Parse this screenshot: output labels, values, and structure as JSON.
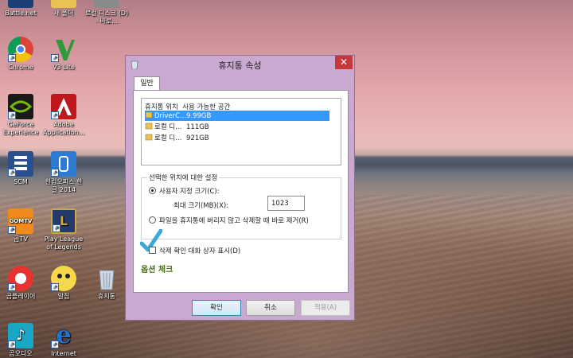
{
  "desktop": {
    "icons": [
      {
        "label": "Battle.net",
        "color": "#1c3f7a"
      },
      {
        "label": "새 폴더",
        "color": "#e8c252"
      },
      {
        "label": "로컬 디스크 (D) - 바로...",
        "color": "#8a8a8a"
      },
      {
        "label": "Chrome",
        "color": "#3a7de0"
      },
      {
        "label": "V3 Lite",
        "color": "#2f9a3a"
      },
      {
        "label": "GeForce Experience",
        "color": "#76b900"
      },
      {
        "label": "Adobe Application...",
        "color": "#c0171c"
      },
      {
        "label": "SCM",
        "color": "#2a4f8f"
      },
      {
        "label": "한컴오피스 한글 2014",
        "color": "#2e7bd4"
      },
      {
        "label": "곰TV",
        "color": "#f08a1d"
      },
      {
        "label": "Play League of Legends",
        "color": "#243a6a"
      },
      {
        "label": "곰플레이어",
        "color": "#e8322f"
      },
      {
        "label": "알집",
        "color": "#f6d84a"
      },
      {
        "label": "휴지통",
        "color": "#9aa6b4"
      },
      {
        "label": "곰오디오",
        "color": "#1aa7c6"
      },
      {
        "label": "Internet Explorer",
        "color": "#1f73d1"
      }
    ]
  },
  "dialog": {
    "title": "휴지통 속성",
    "close_symbol": "✕",
    "tab_general": "일반",
    "list": {
      "col_location": "휴지통 위치",
      "col_space": "사용 가능한 공간",
      "rows": [
        {
          "name": "DriverC...",
          "space": "9.99GB",
          "selected": true
        },
        {
          "name": "로컬 디...",
          "space": "111GB",
          "selected": false
        },
        {
          "name": "로컬 디...",
          "space": "921GB",
          "selected": false
        }
      ]
    },
    "group": {
      "label": "선택한 위치에 대한 설정",
      "custom_size_label": "사용자 지정 크기(C):",
      "max_size_label": "최대 크기(MB)(X):",
      "max_size_value": "1023",
      "delete_immediately_label": "파일을 휴지통에 버리지 않고 삭제할 때 바로 제거(R)"
    },
    "confirm_checkbox_label": "삭제 확인 대화 상자 표시(D)",
    "annotation": "옵션 체크",
    "buttons": {
      "ok": "확인",
      "cancel": "취소",
      "apply": "적용(A)"
    }
  },
  "colors": {
    "selection": "#3399ff",
    "close_button": "#c7383d",
    "window_frame": "#c9a9d0",
    "annotation_green": "#4a6d1a",
    "check_mark": "#3aa9d9"
  }
}
